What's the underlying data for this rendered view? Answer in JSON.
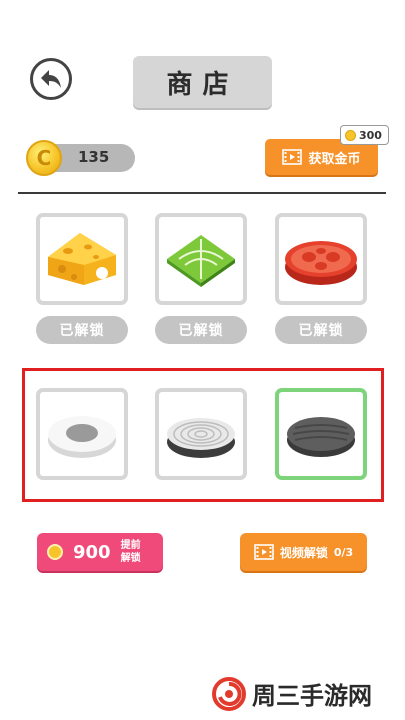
{
  "header": {
    "title": "商店"
  },
  "wallet": {
    "coins": "135"
  },
  "get_coins": {
    "label": "获取金币",
    "reward": "300"
  },
  "items_row1": [
    {
      "name": "cheese",
      "status": "已解锁"
    },
    {
      "name": "lettuce",
      "status": "已解锁"
    },
    {
      "name": "tomato",
      "status": "已解锁"
    }
  ],
  "items_row2": [
    {
      "name": "egg"
    },
    {
      "name": "onion"
    },
    {
      "name": "patty"
    }
  ],
  "unlock_early": {
    "price": "900",
    "label_line1": "提前",
    "label_line2": "解锁"
  },
  "video_unlock": {
    "label": "视频解锁",
    "progress": "0/3"
  },
  "watermark": {
    "text": "周三手游网"
  },
  "colors": {
    "accent_orange": "#f7922a",
    "accent_pink": "#f04a7a",
    "frame_red": "#e02020",
    "selected_green": "#7ed47a"
  }
}
